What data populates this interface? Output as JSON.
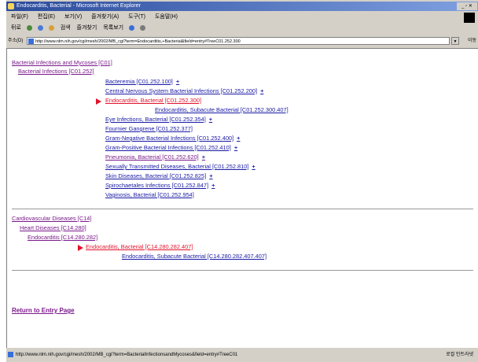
{
  "window": {
    "title": "Endocarditis, Bacterial - Microsoft Internet Explorer",
    "controls": "_ ▫ ✕"
  },
  "menu": [
    "파일(F)",
    "편집(E)",
    "보기(V)",
    "즐겨찾기(A)",
    "도구(T)",
    "도움말(H)"
  ],
  "toolbar": [
    "뒤로",
    "검색",
    "즐겨찾기",
    "목록보기"
  ],
  "address": {
    "label": "주소(D)",
    "url": "http://www.nlm.nih.gov/cgi/mesh/2002/MB_cgi?term=Endocarditis,+Bacterial&field=entry#TreeC01.252.300",
    "go": "이동"
  },
  "tree1": {
    "items": [
      {
        "text": "Bacterial Infections and Mycoses [C01]",
        "color": "purple"
      },
      {
        "text": "Bacterial Infections [C01.252]",
        "color": "purple"
      },
      {
        "text": "Bacteremia [C01.252.100]",
        "plus": "+",
        "color": "blue"
      },
      {
        "text": "Central Nervous System Bacterial Infections [C01.252.200]",
        "plus": "+",
        "color": "blue"
      },
      {
        "text": "Endocarditis, Bacterial [C01.252.300]",
        "color": "red"
      },
      {
        "text": "Endocarditis, Subacute Bacterial [C01.252.300.407]",
        "color": "blue"
      },
      {
        "text": "Eye Infections, Bacterial [C01.252.354]",
        "plus": "+",
        "color": "blue"
      },
      {
        "text": "Fournier Gangrene [C01.252.377]",
        "color": "blue"
      },
      {
        "text": "Gram-Negative Bacterial Infections [C01.252.400]",
        "plus": "+",
        "color": "blue"
      },
      {
        "text": "Gram-Positive Bacterial Infections [C01.252.410]",
        "plus": "+",
        "color": "blue"
      },
      {
        "text": "Pneumonia, Bacterial [C01.252.620]",
        "plus": "+",
        "color": "purple"
      },
      {
        "text": "Sexually Transmitted Diseases, Bacterial [C01.252.810]",
        "plus": "+",
        "color": "blue"
      },
      {
        "text": "Skin Diseases, Bacterial [C01.252.825]",
        "plus": "+",
        "color": "blue"
      },
      {
        "text": "Spirochaetales Infections [C01.252.847]",
        "plus": "+",
        "color": "blue"
      },
      {
        "text": "Vaginosis, Bacterial [C01.252.954]",
        "color": "blue"
      }
    ]
  },
  "tree2": {
    "items": [
      {
        "text": "Cardiovascular Diseases [C14]",
        "color": "purple"
      },
      {
        "text": "Heart Diseases [C14.280]",
        "color": "purple"
      },
      {
        "text": "Endocarditis [C14.280.282]",
        "color": "purple"
      },
      {
        "text": "Endocarditis, Bacterial [C14.280.282.407]",
        "color": "red"
      },
      {
        "text": "Endocarditis, Subacute Bacterial [C14.280.282.407.407]",
        "color": "blue"
      }
    ]
  },
  "return_link": "Return to Entry Page",
  "status": {
    "url": "http://www.nlm.nih.gov/cgi/mesh/2002/MB_cgi?term=BacterialInfectionsandMycoses&field=entry#TreeC01",
    "zone": "로컬 인트라넷"
  },
  "colors": {
    "link": "#1a1aa6",
    "visited": "#7a1a8a",
    "current": "#e0142c"
  }
}
